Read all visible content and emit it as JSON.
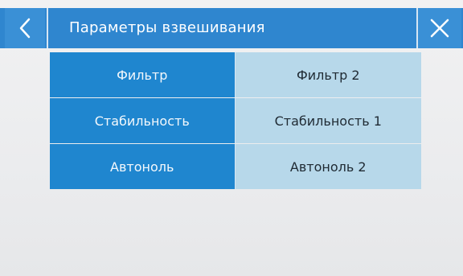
{
  "header": {
    "title": "Параметры взвешивания",
    "back_icon": "chevron-left-icon",
    "close_icon": "close-icon"
  },
  "settings": [
    {
      "label": "Фильтр",
      "value": "Фильтр 2"
    },
    {
      "label": "Стабильность",
      "value": "Стабильность 1"
    },
    {
      "label": "Автоноль",
      "value": "Автоноль 2"
    }
  ],
  "colors": {
    "header_bg": "#2f86cf",
    "label_bg": "#1f86cf",
    "value_bg": "#b7d8ea",
    "background": "#ececee"
  }
}
